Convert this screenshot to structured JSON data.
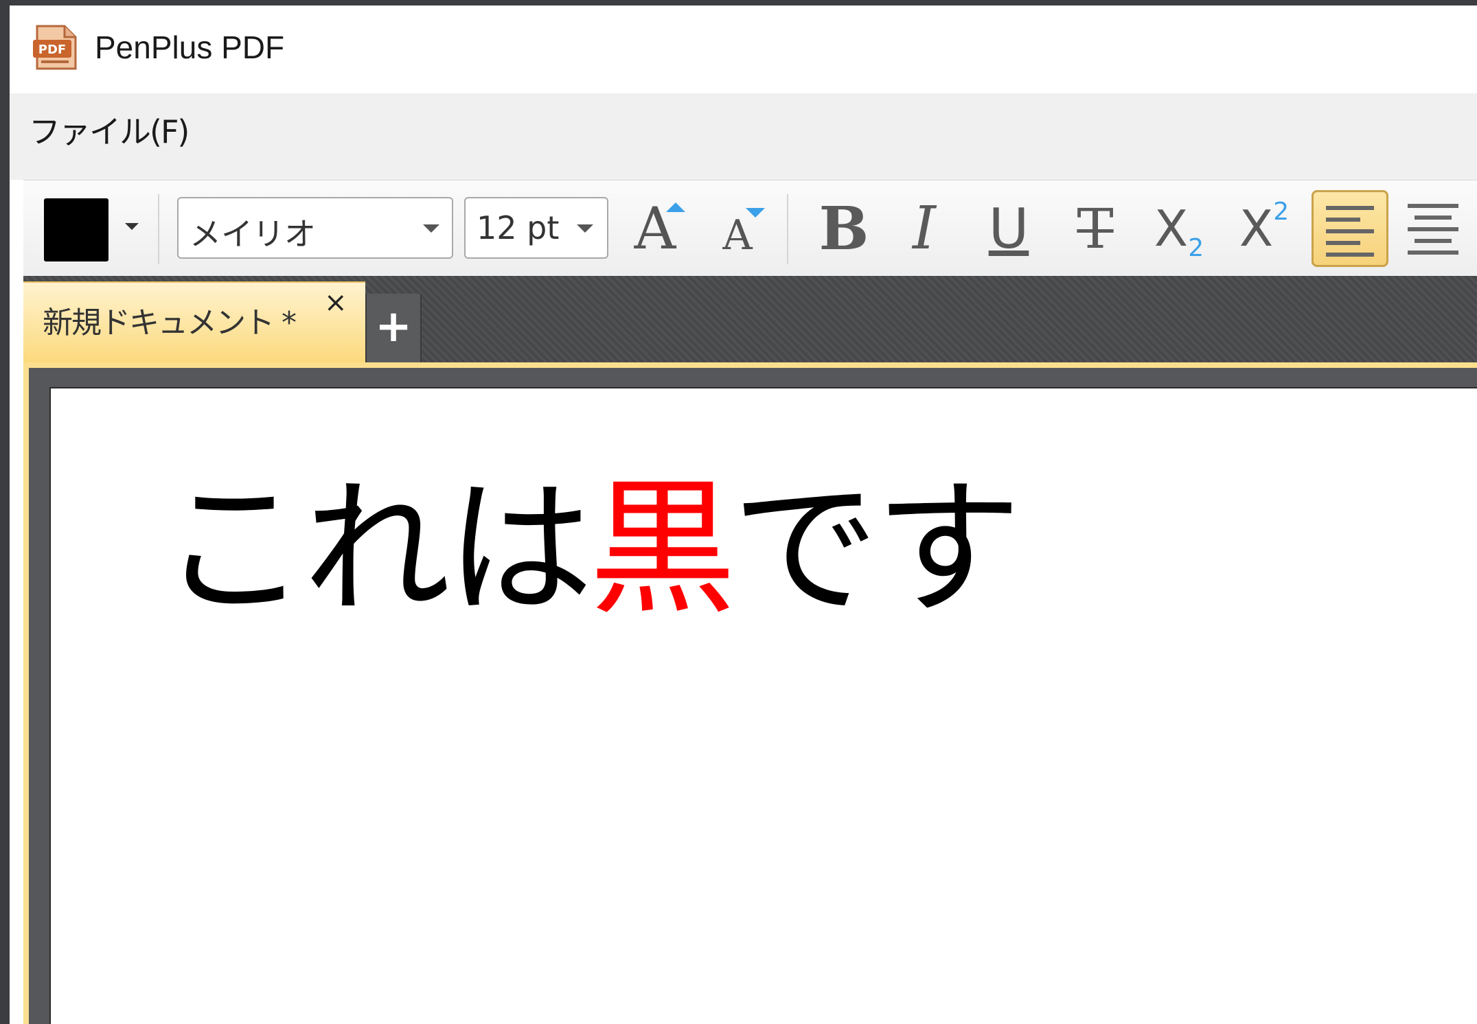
{
  "app": {
    "title": "PenPlus PDF",
    "icon_text": "PDF"
  },
  "menu": {
    "items": [
      "ファイル(F)"
    ]
  },
  "toolbar": {
    "text_color": "#000000",
    "font_name": "メイリオ",
    "font_size": "12 pt",
    "buttons": {
      "grow_font": "A",
      "shrink_font": "A",
      "bold": "B",
      "italic": "I",
      "underline": "U",
      "strikethrough": "T",
      "subscript_base": "X",
      "subscript_index": "2",
      "superscript_base": "X",
      "superscript_index": "2"
    },
    "active_alignment": "left"
  },
  "tabs": [
    {
      "label": "新規ドキュメント *",
      "close_icon": "×",
      "active": true
    }
  ],
  "new_tab_label": "+",
  "document": {
    "text_before": "これは",
    "text_highlight": "黒",
    "text_after": "です",
    "highlight_color": "#ff0000"
  }
}
